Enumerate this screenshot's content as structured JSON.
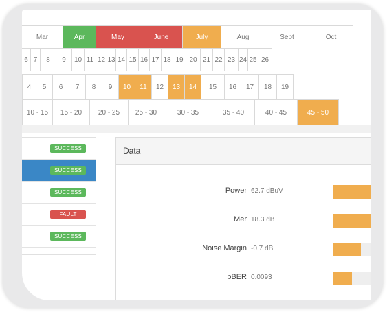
{
  "months": [
    {
      "label": "Mar",
      "style": ""
    },
    {
      "label": "Apr",
      "style": "green"
    },
    {
      "label": "May",
      "style": "red"
    },
    {
      "label": "June",
      "style": "red"
    },
    {
      "label": "July",
      "style": "hi"
    },
    {
      "label": "Aug",
      "style": ""
    },
    {
      "label": "Sept",
      "style": ""
    },
    {
      "label": "Oct",
      "style": ""
    }
  ],
  "days": [
    "6",
    "7",
    "8",
    "9",
    "10",
    "11",
    "12",
    "13",
    "14",
    "15",
    "16",
    "17",
    "18",
    "19",
    "20",
    "21",
    "22",
    "23",
    "24",
    "25",
    "26"
  ],
  "days2": [
    {
      "label": "4",
      "style": ""
    },
    {
      "label": "5",
      "style": ""
    },
    {
      "label": "6",
      "style": ""
    },
    {
      "label": "7",
      "style": ""
    },
    {
      "label": "8",
      "style": ""
    },
    {
      "label": "9",
      "style": ""
    },
    {
      "label": "10",
      "style": "hi"
    },
    {
      "label": "11",
      "style": "hi"
    },
    {
      "label": "12",
      "style": ""
    },
    {
      "label": "13",
      "style": "hi"
    },
    {
      "label": "14",
      "style": "hi"
    },
    {
      "label": "15",
      "style": ""
    },
    {
      "label": "16",
      "style": ""
    },
    {
      "label": "17",
      "style": ""
    },
    {
      "label": "18",
      "style": ""
    },
    {
      "label": "19",
      "style": ""
    }
  ],
  "ranges": [
    {
      "label": "10 - 15",
      "style": ""
    },
    {
      "label": "15 - 20",
      "style": ""
    },
    {
      "label": "20 - 25",
      "style": ""
    },
    {
      "label": "25 - 30",
      "style": ""
    },
    {
      "label": "30 - 35",
      "style": ""
    },
    {
      "label": "35 - 40",
      "style": ""
    },
    {
      "label": "40 - 45",
      "style": ""
    },
    {
      "label": "45 - 50",
      "style": "hi"
    }
  ],
  "status_list": [
    {
      "badge": "SUCCESS",
      "status": "ok",
      "active": false
    },
    {
      "badge": "SUCCESS",
      "status": "ok",
      "active": true
    },
    {
      "badge": "SUCCESS",
      "status": "ok",
      "active": false
    },
    {
      "badge": "FAULT",
      "status": "fault",
      "active": false
    },
    {
      "badge": "SUCCESS",
      "status": "ok",
      "active": false
    }
  ],
  "panel": {
    "title": "Data",
    "metrics": [
      {
        "name": "Power",
        "value": "62.7 dBuV",
        "level": 1.0
      },
      {
        "name": "Mer",
        "value": "18.3 dB",
        "level": 1.0
      },
      {
        "name": "Noise Margin",
        "value": "-0.7 dB",
        "level": 0.62
      },
      {
        "name": "bBER",
        "value": "0.0093",
        "level": 0.42
      }
    ]
  },
  "colors": {
    "orange": "#f0ad4e",
    "green": "#5cb85c",
    "red": "#d9534f",
    "blue": "#3a87c6"
  }
}
